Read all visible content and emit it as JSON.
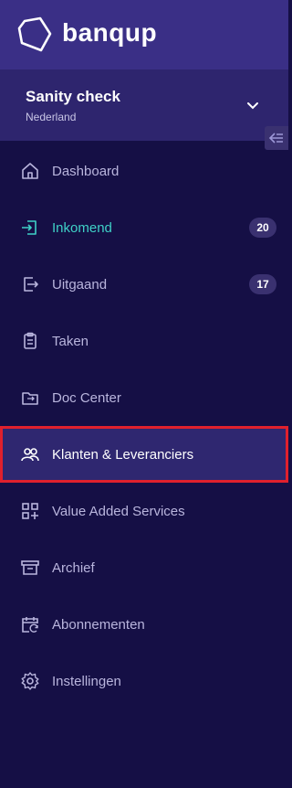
{
  "app": {
    "brand": "banqup"
  },
  "org": {
    "name": "Sanity check",
    "country": "Nederland"
  },
  "nav": {
    "items": [
      {
        "label": "Dashboard",
        "icon": "home-icon"
      },
      {
        "label": "Inkomend",
        "icon": "inbox-arrow-icon",
        "badge": "20",
        "active": true
      },
      {
        "label": "Uitgaand",
        "icon": "outbox-arrow-icon",
        "badge": "17"
      },
      {
        "label": "Taken",
        "icon": "clipboard-icon"
      },
      {
        "label": "Doc Center",
        "icon": "folder-exchange-icon"
      },
      {
        "label": "Klanten & Leveranciers",
        "icon": "users-icon",
        "selected": true
      },
      {
        "label": "Value Added Services",
        "icon": "apps-add-icon"
      },
      {
        "label": "Archief",
        "icon": "archive-icon"
      },
      {
        "label": "Abonnementen",
        "icon": "calendar-refresh-icon"
      },
      {
        "label": "Instellingen",
        "icon": "gear-icon"
      }
    ]
  },
  "colors": {
    "background": "#150f45",
    "header": "#3a2f86",
    "accent": "#3fd1c7",
    "highlight": "#e0202d"
  }
}
